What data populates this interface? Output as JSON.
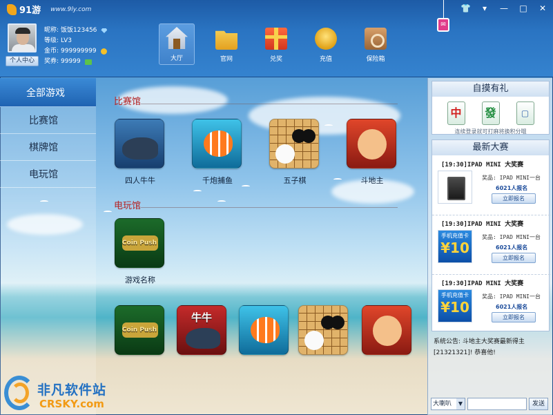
{
  "app": {
    "logo_text": "91游",
    "url": "www.9ly.com"
  },
  "window_controls": {
    "skin": "👕",
    "menu": "▾",
    "minimize": "—",
    "maximize": "□",
    "close": "✕"
  },
  "user": {
    "profile_button": "个人中心",
    "nickname_label": "昵称:",
    "nickname": "饭饭123456",
    "level_label": "等级:",
    "level": "LV3",
    "gold_label": "金币:",
    "gold": "999999999",
    "ticket_label": "奖券:",
    "tickets": "99999"
  },
  "nav": {
    "items": [
      {
        "label": "大厅",
        "icon": "home-icon"
      },
      {
        "label": "官网",
        "icon": "folder-icon"
      },
      {
        "label": "兑奖",
        "icon": "gift-icon"
      },
      {
        "label": "充值",
        "icon": "coins-icon"
      },
      {
        "label": "保险箱",
        "icon": "safe-icon"
      }
    ]
  },
  "sidebar": {
    "items": [
      {
        "label": "全部游戏"
      },
      {
        "label": "比赛馆"
      },
      {
        "label": "棋牌馆"
      },
      {
        "label": "电玩馆"
      }
    ]
  },
  "main": {
    "sections": [
      {
        "title": "比赛馆",
        "games": [
          {
            "label": "四人牛牛"
          },
          {
            "label": "千炮捕鱼"
          },
          {
            "label": "五子棋"
          },
          {
            "label": "斗地主"
          }
        ]
      },
      {
        "title": "电玩馆",
        "games": [
          {
            "label": "游戏名称",
            "overlay": "Coin Push"
          }
        ]
      }
    ],
    "bottom_row": [
      {
        "overlay": "Coin Push"
      },
      {
        "overlay": "牛牛"
      },
      {
        "overlay": ""
      },
      {
        "overlay": ""
      },
      {
        "overlay": ""
      }
    ]
  },
  "right_panel": {
    "bonus": {
      "title": "自摸有礼",
      "tiles": [
        "中",
        "發",
        "▢"
      ],
      "note": "连续登录就可打麻将换积分哦"
    },
    "matches": {
      "title": "最新大赛",
      "items": [
        {
          "title": "[19:30]IPAD MINI 大奖赛",
          "prize": "奖品: IPAD MINI一台",
          "count": "6021人报名",
          "button": "立即报名",
          "image": "ipad"
        },
        {
          "title": "[19:30]IPAD MINI 大奖赛",
          "prize": "奖品: IPAD MINI一台",
          "count": "6021人报名",
          "button": "立即报名",
          "image": "card",
          "card_top": "手机充值卡",
          "card_value": "¥10"
        },
        {
          "title": "[19:30]IPAD MINI 大奖赛",
          "prize": "奖品: IPAD MINI一台",
          "count": "6021人报名",
          "button": "立即报名",
          "image": "card",
          "card_top": "手机充值卡",
          "card_value": "¥10"
        }
      ]
    },
    "notice": "系统公告: 斗地主大奖赛最新得主[21321321]! 恭喜他!",
    "chat": {
      "channel": "大喇叭",
      "send": "发送"
    }
  },
  "watermark": {
    "title": "非凡软件站",
    "url": "CRSKY.com"
  }
}
